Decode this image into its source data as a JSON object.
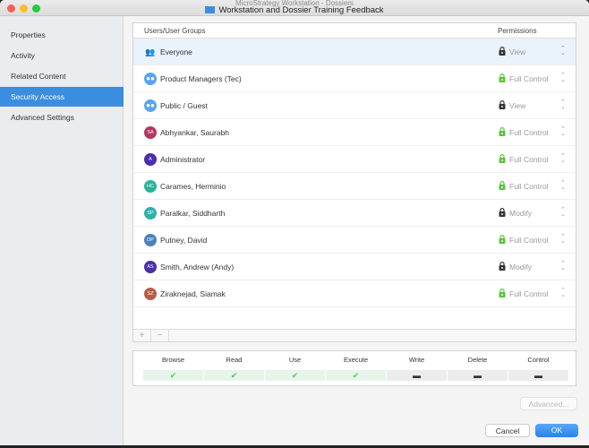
{
  "window": {
    "background_title": "MicroStrategy Workstation - Dossiers",
    "title": "Workstation and Dossier Training Feedback"
  },
  "sidebar": {
    "items": [
      {
        "label": "Properties"
      },
      {
        "label": "Activity"
      },
      {
        "label": "Related Content"
      },
      {
        "label": "Security Access",
        "selected": true
      },
      {
        "label": "Advanced Settings"
      }
    ]
  },
  "table": {
    "col_users": "Users/User Groups",
    "col_permissions": "Permissions",
    "rows": [
      {
        "name": "Everyone",
        "type": "everyone",
        "permission": "View",
        "lock": "dark"
      },
      {
        "name": "Product Managers (Tec)",
        "type": "group",
        "permission": "Full Control",
        "lock": "green"
      },
      {
        "name": "Public / Guest",
        "type": "group",
        "permission": "View",
        "lock": "dark"
      },
      {
        "name": "Abhyankar, Saurabh",
        "initials": "SA",
        "color": "#b5365f",
        "permission": "Full Control",
        "lock": "green"
      },
      {
        "name": "Administrator",
        "initials": "A",
        "color": "#4a2fb0",
        "permission": "Full Control",
        "lock": "green"
      },
      {
        "name": "Carames, Herminio",
        "initials": "HC",
        "color": "#2bb39a",
        "permission": "Full Control",
        "lock": "green"
      },
      {
        "name": "Paralkar, Siddharth",
        "initials": "SP",
        "color": "#2fb2a8",
        "permission": "Modify",
        "lock": "dark"
      },
      {
        "name": "Putney, David",
        "initials": "DP",
        "color": "#4a83b8",
        "permission": "Full Control",
        "lock": "green"
      },
      {
        "name": "Smith, Andrew (Andy)",
        "initials": "AS",
        "color": "#4a30a8",
        "permission": "Modify",
        "lock": "dark"
      },
      {
        "name": "Ziraknejad, Siamak",
        "initials": "SZ",
        "color": "#b55e4a",
        "permission": "Full Control",
        "lock": "green"
      }
    ],
    "add": "+",
    "remove": "−"
  },
  "rights": [
    {
      "label": "Browse",
      "granted": true
    },
    {
      "label": "Read",
      "granted": true
    },
    {
      "label": "Use",
      "granted": true
    },
    {
      "label": "Execute",
      "granted": true
    },
    {
      "label": "Write",
      "granted": false
    },
    {
      "label": "Delete",
      "granted": false
    },
    {
      "label": "Control",
      "granted": false
    }
  ],
  "buttons": {
    "advanced": "Advanced...",
    "cancel": "Cancel",
    "ok": "OK"
  },
  "colors": {
    "accent": "#3b8de0",
    "green": "#5cc33d"
  }
}
